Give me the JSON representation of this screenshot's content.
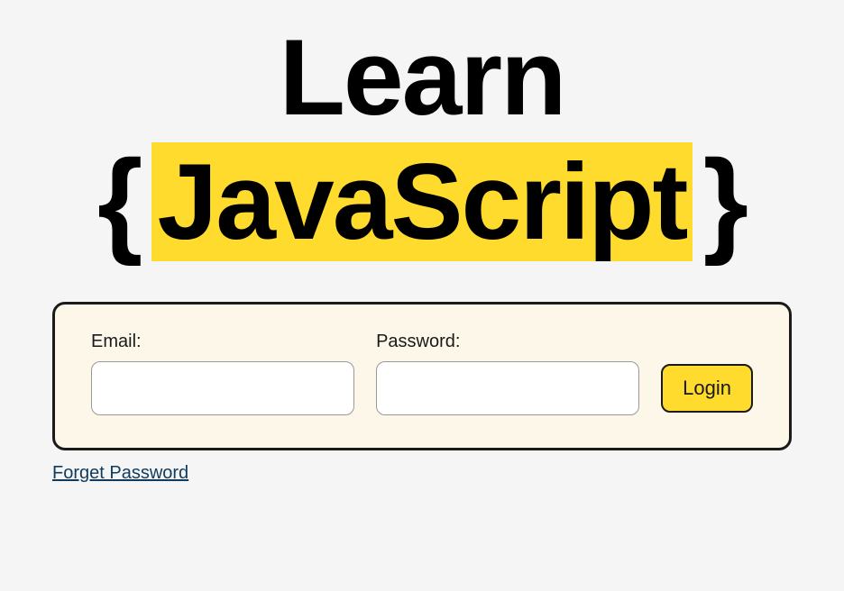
{
  "logo": {
    "line1": "Learn",
    "brace_left": "{",
    "highlight_text": "JavaScript",
    "brace_right": "}"
  },
  "form": {
    "email_label": "Email:",
    "email_value": "",
    "password_label": "Password:",
    "password_value": "",
    "login_button": "Login"
  },
  "links": {
    "forget_password": "Forget Password"
  }
}
